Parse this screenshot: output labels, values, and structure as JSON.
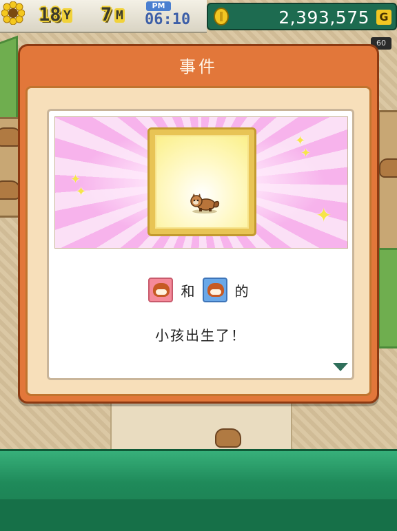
{
  "hud": {
    "years": "18",
    "year_unit": "Y",
    "months": "7",
    "month_unit": "M",
    "period": "PM",
    "time": "06:10",
    "money": "2,393,575",
    "currency": "G",
    "corner_tag": "60"
  },
  "dialog": {
    "title": "事件",
    "message_and": "和",
    "message_of": "的",
    "message_line2": "小孩出生了！"
  },
  "icons": {
    "flower": "sunflower-icon",
    "coin": "gold-coin-icon",
    "baby": "red-panda-baby-icon",
    "parent_female": "red-panda-female-icon",
    "parent_male": "red-panda-male-icon",
    "next": "down-triangle-icon"
  },
  "colors": {
    "dialog_orange": "#e2773a",
    "money_bar_green": "#1d6b50",
    "bottom_bar_green": "#1f8a5a",
    "burst_pink": "#f7b3ec",
    "frame_gold": "#e8c455"
  }
}
